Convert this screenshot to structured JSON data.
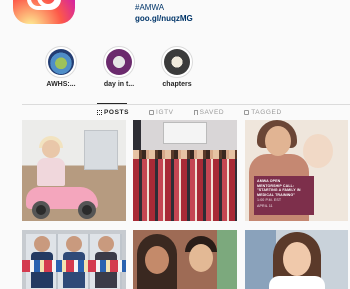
{
  "profile": {
    "bio_hashtag": "#AMWA",
    "bio_link": "goo.gl/nuqzMG"
  },
  "highlights": [
    {
      "label": "AWHS:..."
    },
    {
      "label": "day in t..."
    },
    {
      "label": "chapters"
    }
  ],
  "tabs": [
    {
      "label": "POSTS",
      "icon": "grid-icon",
      "active": true
    },
    {
      "label": "IGTV",
      "icon": "igtv-icon",
      "active": false
    },
    {
      "label": "SAVED",
      "icon": "bookmark-icon",
      "active": false
    },
    {
      "label": "TAGGED",
      "icon": "tagged-icon",
      "active": false
    }
  ],
  "posts": {
    "card_text": {
      "line1": "AMWA OPEN",
      "line2": "MENTORSHIP CALL:",
      "line3": "\"STARTING A FAMILY IN",
      "line4": "MEDICAL TRAINING\"",
      "sub1": "1:00 P.M. EST",
      "sub2": "APRIL 11"
    }
  },
  "colors": {
    "accent_link": "#003569",
    "tab_active": "#262626",
    "tab_inactive": "#999999",
    "card_bg": "#7d2f4b"
  }
}
